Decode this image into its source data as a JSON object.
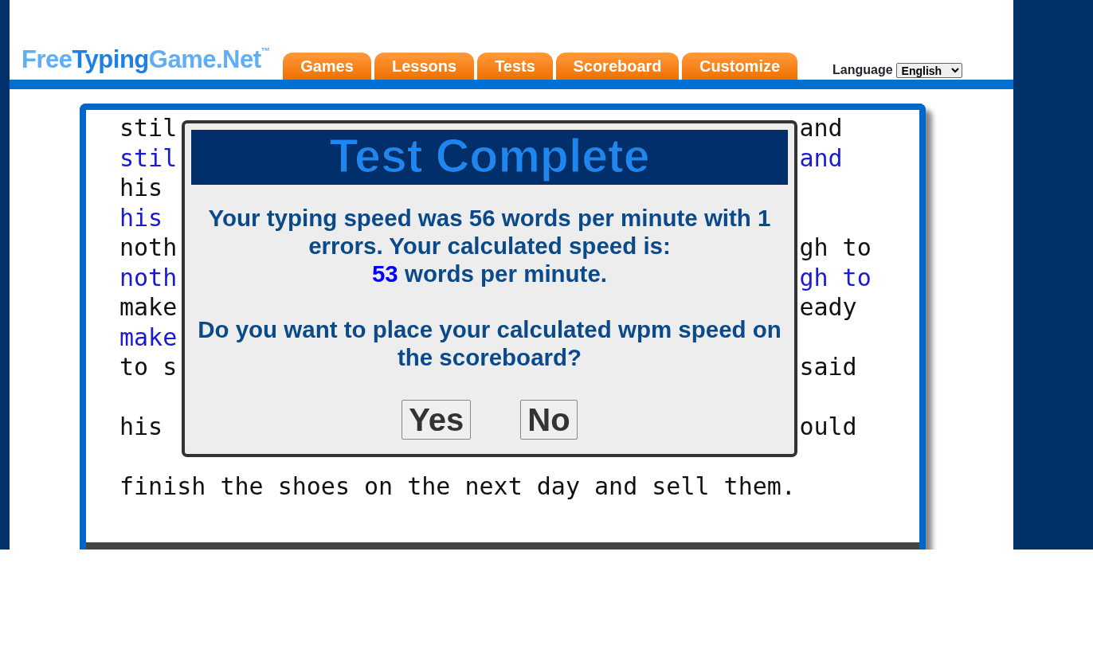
{
  "logo": {
    "parts": [
      {
        "text": "Free",
        "emphasis": false
      },
      {
        "text": "Typing",
        "emphasis": true
      },
      {
        "text": "Game.Net",
        "emphasis": false
      }
    ],
    "trademark": "™"
  },
  "tabs": [
    {
      "label": "Games"
    },
    {
      "label": "Lessons"
    },
    {
      "label": "Tests"
    },
    {
      "label": "Scoreboard"
    },
    {
      "label": "Customize"
    }
  ],
  "language": {
    "label": "Language",
    "value": "English"
  },
  "passage": [
    {
      "kind": "source",
      "left": "stil",
      "right": "and"
    },
    {
      "kind": "typed",
      "left": "stil",
      "right": "and"
    },
    {
      "kind": "source",
      "left": "his"
    },
    {
      "kind": "typed",
      "left": "his"
    },
    {
      "kind": "source",
      "left": "noth",
      "right": "gh to"
    },
    {
      "kind": "typed",
      "left": "noth",
      "right": "gh to"
    },
    {
      "kind": "source",
      "left": "make",
      "right": "eady"
    },
    {
      "kind": "typed",
      "left": "make"
    },
    {
      "kind": "source",
      "left": "to s",
      "right": "said"
    },
    {
      "kind": "blank"
    },
    {
      "kind": "source",
      "left": "his",
      "right": "ould"
    },
    {
      "kind": "blank"
    },
    {
      "kind": "source",
      "left": "finish the shoes on the next day and sell them."
    }
  ],
  "dialog": {
    "title": "Test Complete",
    "result_text": "Your typing speed was 56 words per minute with 1 errors. Your calculated speed is:",
    "calculated_wpm": "53",
    "calculated_unit": "words per minute.",
    "question": "Do you want to place your calculated wpm speed on the scoreboard?",
    "buttons": [
      "Yes",
      "No"
    ]
  }
}
